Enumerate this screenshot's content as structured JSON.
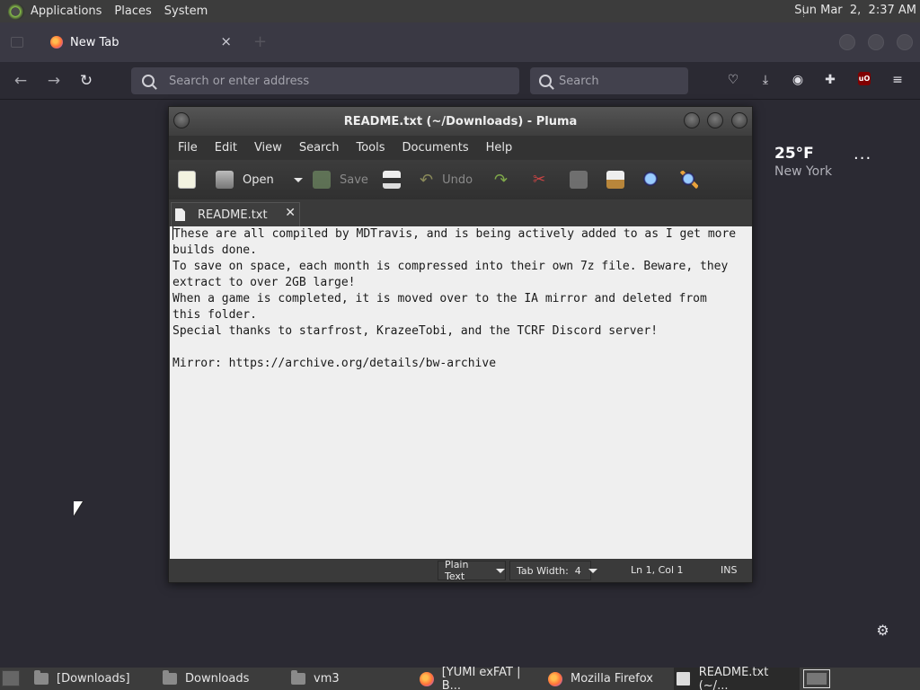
{
  "top_panel": {
    "menus": [
      "Applications",
      "Places",
      "System"
    ],
    "clock": "Sun Mar  2,  2:37 AM"
  },
  "browser": {
    "tab_title": "New Tab",
    "tab_close": "×",
    "url_placeholder": "Search or enter address",
    "search_placeholder": "Search",
    "new_tab_plus": "+"
  },
  "newtab": {
    "weather_temp": "25°F",
    "weather_city": "New York",
    "more": "···"
  },
  "pluma": {
    "title": "README.txt (~/Downloads) - Pluma",
    "menu": [
      "File",
      "Edit",
      "View",
      "Search",
      "Tools",
      "Documents",
      "Help"
    ],
    "toolbar": {
      "open_label": "Open",
      "save_label": "Save",
      "undo_label": "Undo"
    },
    "tab_label": "README.txt",
    "tab_close": "✕",
    "content": "These are all compiled by MDTravis, and is being actively added to as I get more\nbuilds done.\nTo save on space, each month is compressed into their own 7z file. Beware, they\nextract to over 2GB large!\nWhen a game is completed, it is moved over to the IA mirror and deleted from\nthis folder.\nSpecial thanks to starfrost, KrazeeTobi, and the TCRF Discord server!\n\nMirror: https://archive.org/details/bw-archive",
    "status": {
      "syntax": "Plain Text",
      "tab_width": "Tab Width:  4",
      "position": "Ln 1, Col 1",
      "mode": "INS"
    }
  },
  "taskbar": {
    "items": [
      "[Downloads]",
      "Downloads",
      "vm3",
      "[YUMI exFAT | B...",
      "Mozilla Firefox",
      "README.txt (~/..."
    ]
  }
}
